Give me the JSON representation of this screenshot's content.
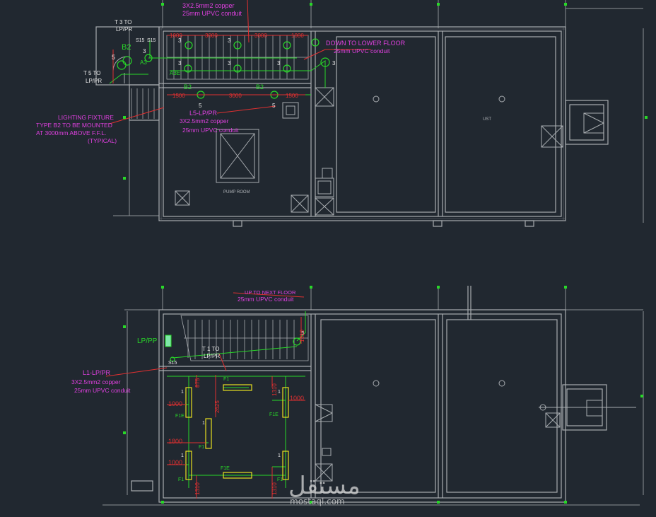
{
  "top_plan": {
    "room_labels": {
      "pump_room": "PUMP ROOM",
      "ust": "UST"
    },
    "panel_upper": {
      "circuit": "T 3 TO",
      "board": "LP/PR"
    },
    "panel_lower": {
      "circuit": "T 5 TO",
      "board": "LP/PR"
    },
    "switch_labels": [
      "S15",
      "S15"
    ],
    "type_label": "B2",
    "circuit_a3": "A3",
    "circuit_a3e": "A3E",
    "note_top_cable": [
      "3X2.5mm2 copper",
      "25mm UPVC conduit"
    ],
    "note_down": [
      "DOWN TO LOWER FLOOR",
      "25mm UPVC conduit"
    ],
    "note_fixture": [
      "LIGHTING FIXTURE",
      "TYPE B2 TO BE MOUNTED",
      "AT 3000mm ABOVE F.F.L.",
      "(TYPICAL)"
    ],
    "note_l5": [
      "L5-LP/PR",
      "3X2.5mm2 copper",
      "25mm UPVC conduit"
    ],
    "dims_top": [
      "1000",
      "3000",
      "3000",
      "1000"
    ],
    "dims_mid": [
      "1500",
      "3000",
      "1500"
    ],
    "b2_fixture_labels": [
      "B2",
      "B2"
    ],
    "fixture_numbers": [
      "3",
      "3",
      "3",
      "3",
      "3",
      "3",
      "5",
      "5",
      "5",
      "3"
    ]
  },
  "bottom_plan": {
    "note_up": [
      "UP TO NEXT FLOOR",
      "25mm UPVC conduit"
    ],
    "panel_label": "LP/PP",
    "panel_circuit": {
      "circuit": "T 1 TO",
      "board": "LP/PR"
    },
    "switch_label": "S15",
    "note_l1": [
      "L1-LP/PR",
      "3X2.5mm2 copper",
      "25mm UPVC conduit"
    ],
    "fixture_f1": "F1",
    "fixture_f1e": "F1E",
    "dims": [
      "1000",
      "1000",
      "1800",
      "1000",
      "2625",
      "1310",
      "1310",
      "1310",
      "1310",
      "875"
    ],
    "fixture_number": "1",
    "fixture_three": "3"
  },
  "watermark": {
    "arabic": "مستقل",
    "latin": "mostaql.com"
  },
  "colors": {
    "background": "#212830",
    "wall": "#a8acb0",
    "annotation": "#e040e0",
    "circuit": "#28d828",
    "dimension": "#e03030",
    "fixture": "#e8e020"
  }
}
